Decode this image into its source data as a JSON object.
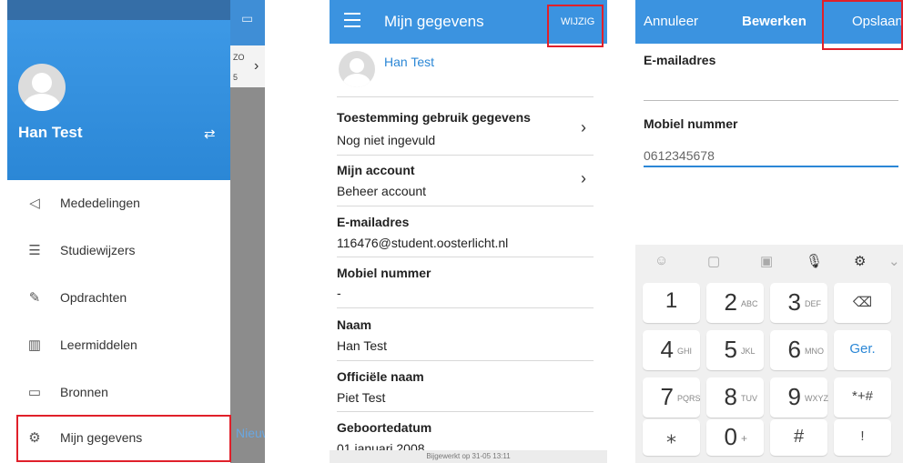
{
  "panel1": {
    "user_name": "Han Test",
    "bg": {
      "col_zo": "ZO",
      "col_num": "5",
      "nieuw": "Nieuw"
    },
    "menu": [
      {
        "label": "Mededelingen",
        "icon": "megaphone-icon"
      },
      {
        "label": "Studiewijzers",
        "icon": "signpost-icon"
      },
      {
        "label": "Opdrachten",
        "icon": "pencil-icon"
      },
      {
        "label": "Leermiddelen",
        "icon": "books-icon"
      },
      {
        "label": "Bronnen",
        "icon": "folder-icon"
      },
      {
        "label": "Mijn gegevens",
        "icon": "gear-icon"
      }
    ]
  },
  "panel2": {
    "title": "Mijn gegevens",
    "action": "WIJZIG",
    "user_name": "Han Test",
    "rows": [
      {
        "label": "Toestemming gebruik gegevens",
        "value": "Nog niet ingevuld",
        "chevron": true
      },
      {
        "label": "Mijn account",
        "value": "Beheer account",
        "chevron": true
      },
      {
        "label": "E-mailadres",
        "value": "116476@student.oosterlicht.nl"
      },
      {
        "label": "Mobiel nummer",
        "value": "-"
      },
      {
        "label": "Naam",
        "value": "Han Test"
      },
      {
        "label": "Officiële naam",
        "value": "Piet Test"
      },
      {
        "label": "Geboortedatum",
        "value": "01 januari 2008"
      }
    ],
    "footer": "Bijgewerkt op 31-05 13:11"
  },
  "panel3": {
    "cancel": "Annuleer",
    "title": "Bewerken",
    "save": "Opslaan",
    "email_label": "E-mailadres",
    "email_value": "",
    "mobile_label": "Mobiel nummer",
    "mobile_value": "0612345678",
    "keys": [
      {
        "digit": "1",
        "letters": ""
      },
      {
        "digit": "2",
        "letters": "ABC"
      },
      {
        "digit": "3",
        "letters": "DEF"
      },
      {
        "special": "⌫"
      },
      {
        "digit": "4",
        "letters": "GHI"
      },
      {
        "digit": "5",
        "letters": "JKL"
      },
      {
        "digit": "6",
        "letters": "MNO"
      },
      {
        "special": "Ger."
      },
      {
        "digit": "7",
        "letters": "PQRS"
      },
      {
        "digit": "8",
        "letters": "TUV"
      },
      {
        "digit": "9",
        "letters": "WXYZ"
      },
      {
        "special": "*+#"
      },
      {
        "special": "⁎"
      },
      {
        "digit": "0",
        "letters": "+"
      },
      {
        "special": "#"
      },
      {
        "special": "!"
      }
    ]
  },
  "colors": {
    "accent": "#3b93e0",
    "highlight": "#e0202a"
  }
}
